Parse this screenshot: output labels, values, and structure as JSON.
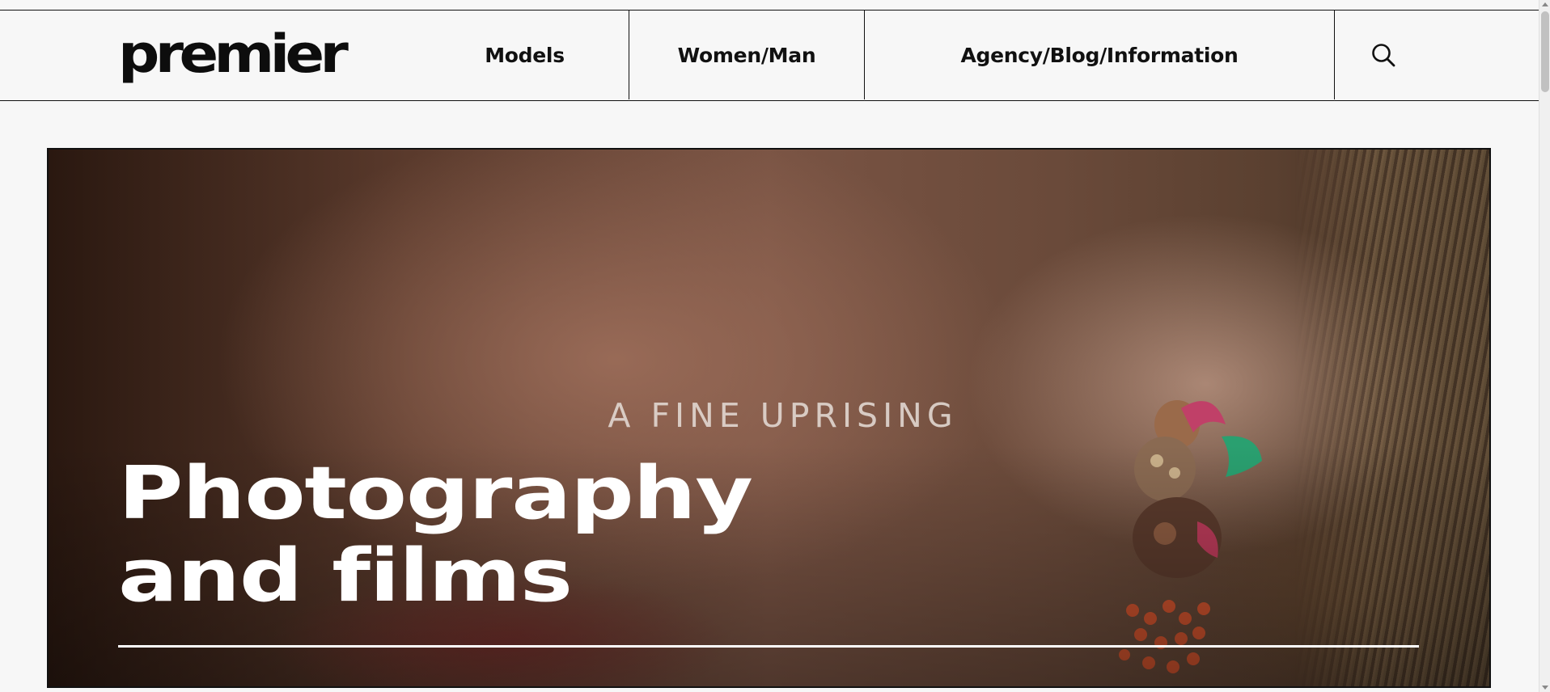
{
  "header": {
    "logo_text": "premier",
    "nav": [
      {
        "label": "Models"
      },
      {
        "label": "Women/Man"
      },
      {
        "label": "Agency/Blog/Information"
      }
    ],
    "search_icon": "search-icon"
  },
  "hero": {
    "tagline": "A FINE UPRISING",
    "title_line1": "Photography",
    "title_line2": "and films"
  },
  "colors": {
    "background": "#f7f7f7",
    "text": "#111111",
    "hero_text": "#ffffff"
  }
}
